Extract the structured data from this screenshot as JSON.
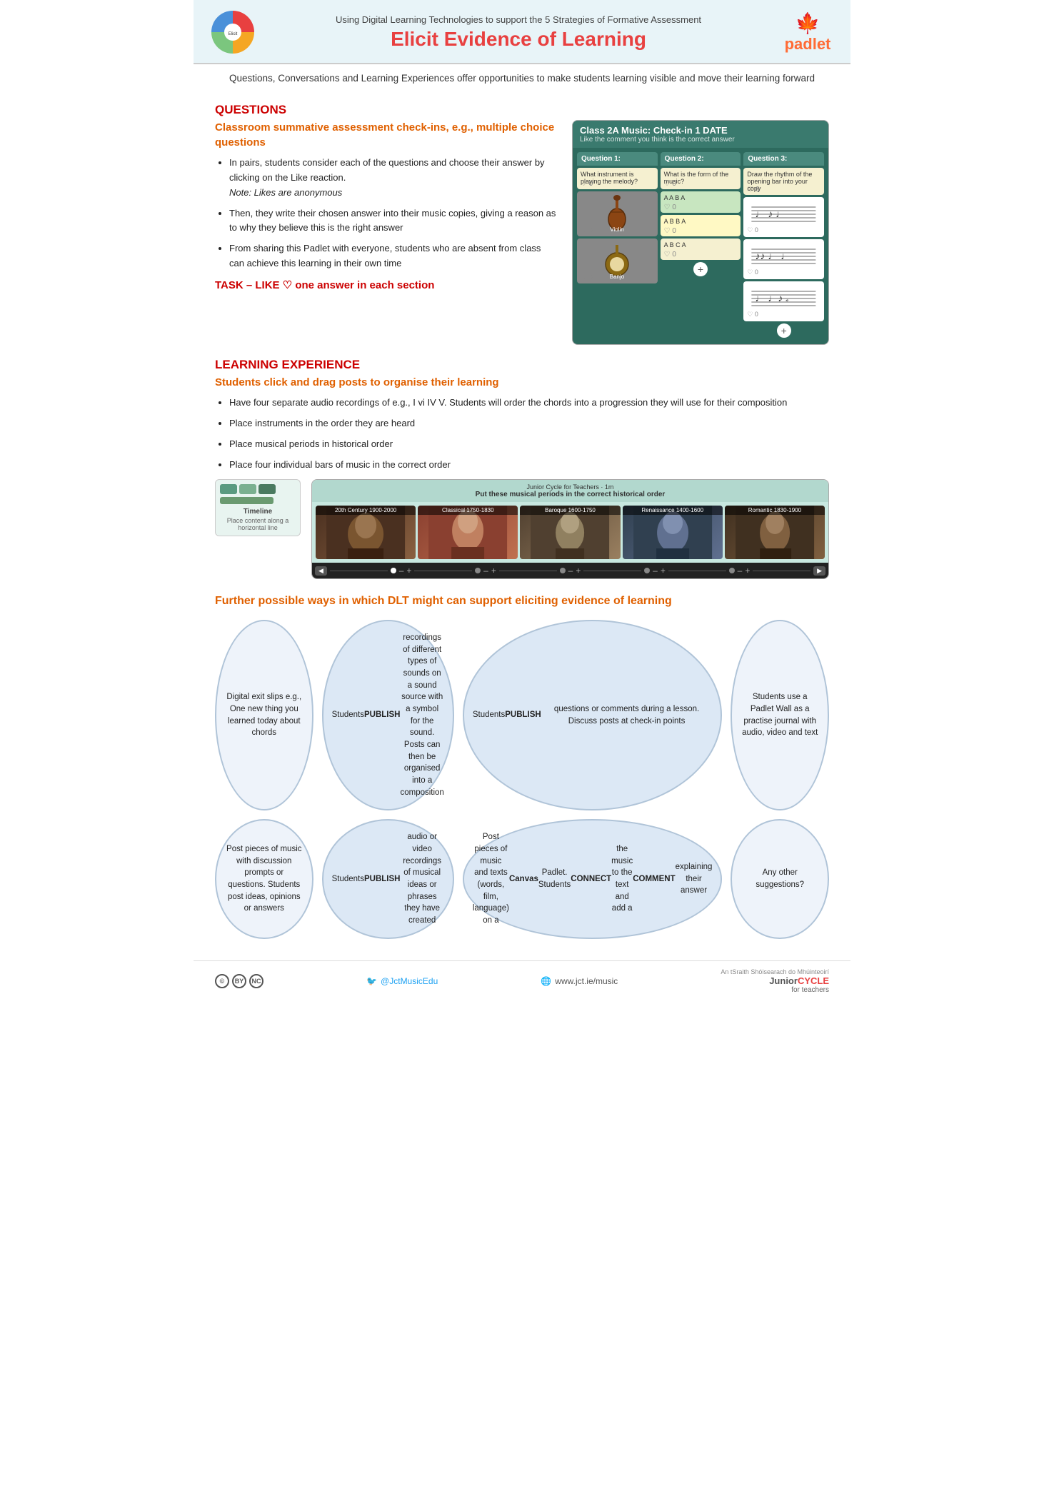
{
  "header": {
    "top_text": "Using Digital Learning Technologies to support the 5 Strategies of Formative Assessment",
    "title": "Elicit Evidence of Learning",
    "padlet_label": "padlet"
  },
  "subtitle": {
    "text": "Questions, Conversations and Learning Experiences offer opportunities to make students learning visible and move their learning forward"
  },
  "questions_section": {
    "section_title": "QUESTIONS",
    "section_subtitle": "Classroom summative assessment check-ins, e.g., multiple choice questions",
    "bullets": [
      "In pairs, students consider each of the questions and choose their answer by clicking on the Like reaction.\nNote: Likes are anonymous",
      "Then, they write their chosen answer into their music copies, giving a reason as to why they believe this is the right answer",
      "From sharing this Padlet with everyone, students who are absent from class can achieve this learning in their own time"
    ],
    "task_line": "TASK – LIKE ♡ one answer in each section",
    "padlet_class_title": "Class 2A Music: Check-in 1 DATE",
    "padlet_subtitle": "Like the comment you think is the correct answer",
    "q1_label": "Question 1:",
    "q1_text": "What instrument is playing the melody?",
    "q2_label": "Question 2:",
    "q2_text": "What is the form of the music?",
    "q3_label": "Question 3:",
    "q3_text": "Draw the rhythm of the opening bar into your copy",
    "answers_q2": [
      "A A B A",
      "A B B A",
      "A B C A"
    ],
    "instrument_1": "Violin",
    "instrument_2": "Banjo"
  },
  "learning_section": {
    "section_title": "LEARNING EXPERIENCE",
    "section_subtitle": "Students click and drag posts to organise their learning",
    "bullets": [
      "Have four separate audio recordings of e.g., I vi IV V. Students will order the chords into a progression they will use for their composition",
      "Place instruments in the order they are heard",
      "Place musical periods in historical order",
      "Place four individual bars of music in the correct order"
    ],
    "timeline_label": "Timeline",
    "timeline_sublabel": "Place content along a horizontal line",
    "timeline_instruction": "Put these musical periods in the correct historical order",
    "small_text": "Junior Cycle for Teachers · 1m",
    "periods": [
      "20th Century 1900-2000",
      "Classical 1750-1830",
      "Baroque 1600-1750",
      "Renaissance 1400-1600",
      "Romantic 1830-1900"
    ]
  },
  "further_section": {
    "title": "Further possible ways in which DLT might can support eliciting evidence of learning",
    "ovals": [
      {
        "text": "Digital exit slips e.g., One new thing you learned today about chords",
        "bold_parts": []
      },
      {
        "text": "Students PUBLISH recordings of different types of sounds on a sound source with a symbol for the sound. Posts can then be organised into a composition",
        "bold_parts": [
          "PUBLISH"
        ]
      },
      {
        "text": "Students PUBLISH questions or comments during a lesson. Discuss posts at check-in points",
        "bold_parts": [
          "PUBLISH"
        ]
      },
      {
        "text": "Students use a Padlet Wall as a practise journal with audio, video and text",
        "bold_parts": []
      },
      {
        "text": "Post pieces of music with discussion prompts or questions. Students post ideas, opinions or answers",
        "bold_parts": []
      },
      {
        "text": "Students PUBLISH audio or video recordings of musical ideas or phrases they have created",
        "bold_parts": [
          "PUBLISH"
        ]
      },
      {
        "text": "Post pieces of music and texts (words, film, language) on a Canvas Padlet. Students CONNECT the music to the text and add a COMMENT explaining their answer",
        "bold_parts": [
          "Canvas",
          "CONNECT",
          "COMMENT"
        ]
      },
      {
        "text": "Any other suggestions?",
        "bold_parts": []
      }
    ]
  },
  "footer": {
    "twitter": "@JctMusicEdu",
    "website": "www.jct.ie/music",
    "junior_cycle_line1": "An tSraith Shóisearach do Mhúinteoirí",
    "junior_cycle_line2": "Junior",
    "junior_cycle_highlight": "CYCLE",
    "for_teachers": "for teachers"
  }
}
